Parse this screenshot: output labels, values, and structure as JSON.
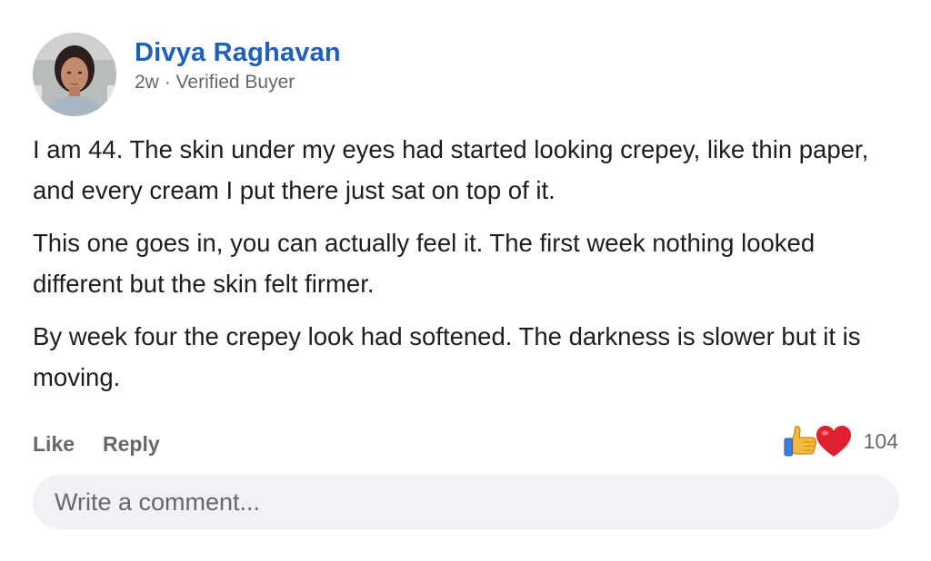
{
  "comment": {
    "author": "Divya Raghavan",
    "time": "2w",
    "separator": "·",
    "badge": "Verified Buyer",
    "paragraphs": [
      "I am 44. The skin under my eyes had started looking crepey, like thin paper, and every cream I put there just sat on top of it.",
      "This one goes in, you can actually feel it. The first week nothing looked different but the skin felt firmer.",
      "By week four the crepey look had softened. The darkness is slower but it is moving."
    ],
    "actions": {
      "like": "Like",
      "reply": "Reply"
    },
    "reactions": {
      "icons": [
        "thumbs-up-icon",
        "heart-icon"
      ],
      "count": "104"
    }
  },
  "composer": {
    "placeholder": "Write a comment..."
  },
  "colors": {
    "author": "#1f5fbf",
    "muted": "#65676b",
    "text": "#1c1e21",
    "input_bg": "#f0f2f5",
    "heart": "#e0202e",
    "thumb": "#f4b93d"
  }
}
